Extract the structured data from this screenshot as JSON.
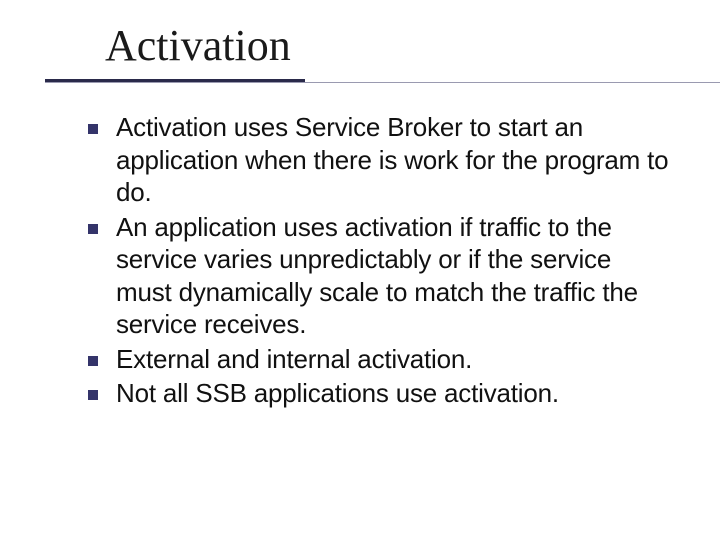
{
  "title": "Activation",
  "bullets": [
    "Activation uses Service Broker to start an application when there is work for the program to do.",
    "An application uses activation if traffic to the service varies unpredictably or if the service must dynamically scale to match the traffic the service receives.",
    "External and internal activation.",
    "Not all SSB applications use activation."
  ]
}
